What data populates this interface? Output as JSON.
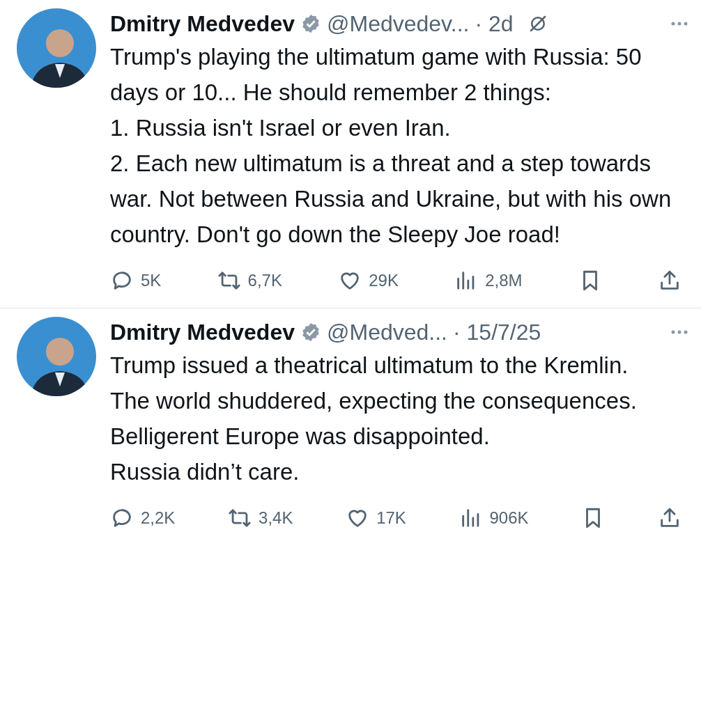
{
  "tweets": [
    {
      "name": "Dmitry Medvedev",
      "handle": "@Medvedev...",
      "time": "· 2d",
      "show_grok": true,
      "paragraphs": [
        "Trump's playing the ultimatum game with Russia: 50 days or 10... He should remember 2 things:",
        "1. Russia isn't Israel or even Iran.",
        "2. Each new ultimatum is a threat and a step towards war. Not between Russia and Ukraine, but with his own country. Don't go down the Sleepy Joe road!"
      ],
      "replies": "5K",
      "reposts": "6,7K",
      "likes": "29K",
      "views": "2,8M"
    },
    {
      "name": "Dmitry Medvedev",
      "handle": "@Medved...",
      "time": "· 15/7/25",
      "show_grok": false,
      "paragraphs": [
        "Trump issued a theatrical ultimatum to the Kremlin.",
        "The world shuddered, expecting the consequences.",
        "Belligerent Europe was disappointed.",
        "Russia didn’t care."
      ],
      "replies": "2,2K",
      "reposts": "3,4K",
      "likes": "17K",
      "views": "906K"
    }
  ]
}
